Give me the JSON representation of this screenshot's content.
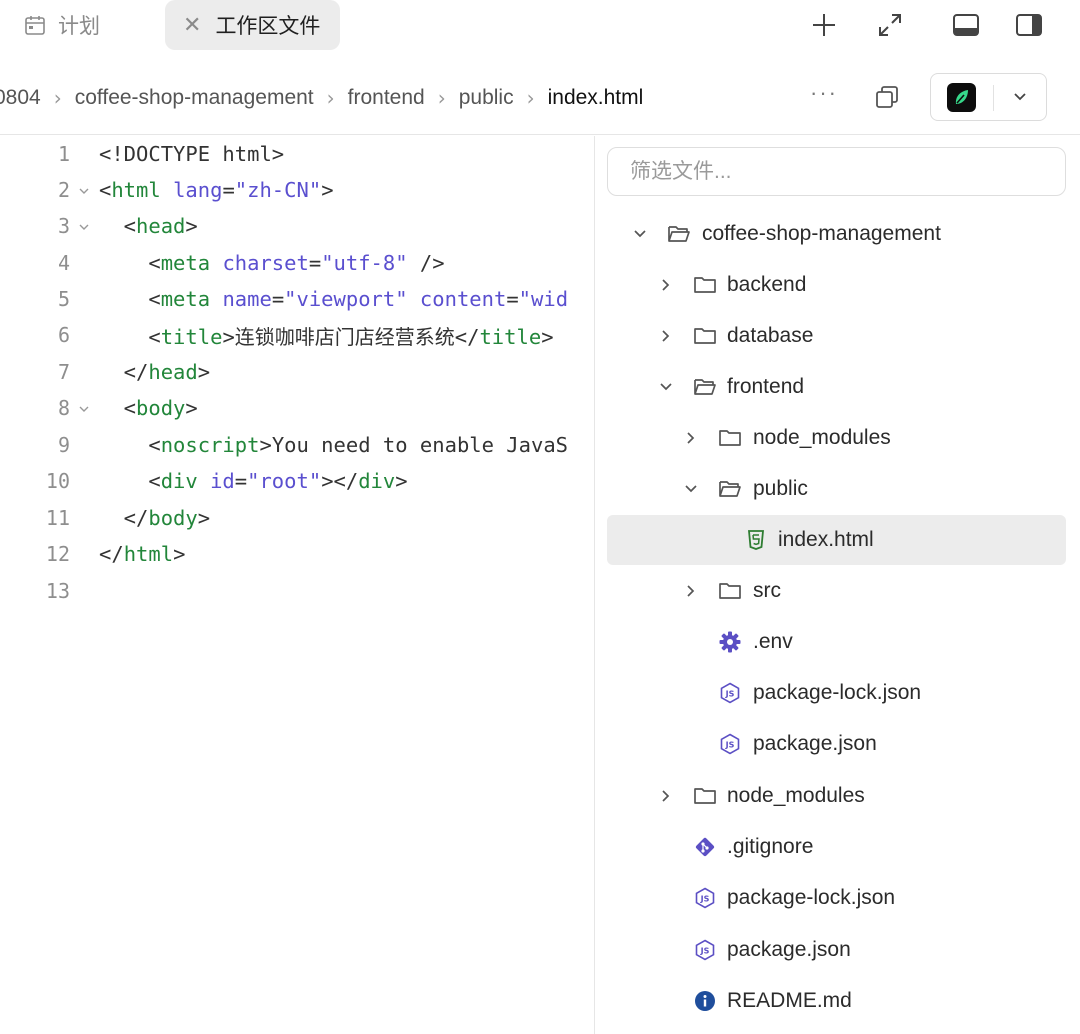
{
  "tabs": {
    "plan": {
      "label": "计划",
      "icon": "calendar-icon"
    },
    "workspace": {
      "label": "工作区文件",
      "close_icon": "close-icon"
    }
  },
  "toolbar_icons": [
    "plus-icon",
    "expand-icon",
    "panel-bottom-icon",
    "panel-right-icon"
  ],
  "breadcrumb": {
    "items": [
      "0804",
      "coffee-shop-management",
      "frontend",
      "public",
      "index.html"
    ],
    "more_label": "···"
  },
  "editor": {
    "lines": [
      {
        "n": "1"
      },
      {
        "n": "2"
      },
      {
        "n": "3"
      },
      {
        "n": "4"
      },
      {
        "n": "5"
      },
      {
        "n": "6"
      },
      {
        "n": "7"
      },
      {
        "n": "8"
      },
      {
        "n": "9"
      },
      {
        "n": "10"
      },
      {
        "n": "11"
      },
      {
        "n": "12"
      },
      {
        "n": "13"
      }
    ],
    "code": {
      "l1": "<!DOCTYPE html>",
      "l2_tag": "html",
      "l2_attr": "lang",
      "l2_val": "\"zh-CN\"",
      "l3_tag": "head",
      "l4_tag": "meta",
      "l4_attr": "charset",
      "l4_val": "\"utf-8\"",
      "l5_tag": "meta",
      "l5_attr1": "name",
      "l5_val1": "\"viewport\"",
      "l5_attr2": "content",
      "l5_val2": "\"wid",
      "l6_tag": "title",
      "l6_text": "连锁咖啡店门店经营系统",
      "l7_tag": "head",
      "l8_tag": "body",
      "l9_tag": "noscript",
      "l9_text": "You need to enable JavaS",
      "l10_tag": "div",
      "l10_attr": "id",
      "l10_val": "\"root\"",
      "l11_tag": "body",
      "l12_tag": "html"
    }
  },
  "file_tree": {
    "filter_placeholder": "筛选文件...",
    "items": [
      {
        "name": "coffee-shop-management",
        "type": "folder-open"
      },
      {
        "name": "backend",
        "type": "folder"
      },
      {
        "name": "database",
        "type": "folder"
      },
      {
        "name": "frontend",
        "type": "folder-open"
      },
      {
        "name": "node_modules",
        "type": "folder"
      },
      {
        "name": "public",
        "type": "folder-open"
      },
      {
        "name": "index.html",
        "type": "html-file",
        "selected": true
      },
      {
        "name": "src",
        "type": "folder"
      },
      {
        "name": ".env",
        "type": "env-file"
      },
      {
        "name": "package-lock.json",
        "type": "js-file"
      },
      {
        "name": "package.json",
        "type": "js-file"
      },
      {
        "name": "node_modules",
        "type": "folder"
      },
      {
        "name": ".gitignore",
        "type": "git-file"
      },
      {
        "name": "package-lock.json",
        "type": "js-file"
      },
      {
        "name": "package.json",
        "type": "js-file"
      },
      {
        "name": "README.md",
        "type": "info-file"
      }
    ]
  },
  "colors": {
    "tag": "#22863a",
    "attr": "#5a4fcf",
    "html_icon": "#2e7d32",
    "tree_icon_purple": "#5b4fc4",
    "readme_icon": "#1f4e9c"
  }
}
